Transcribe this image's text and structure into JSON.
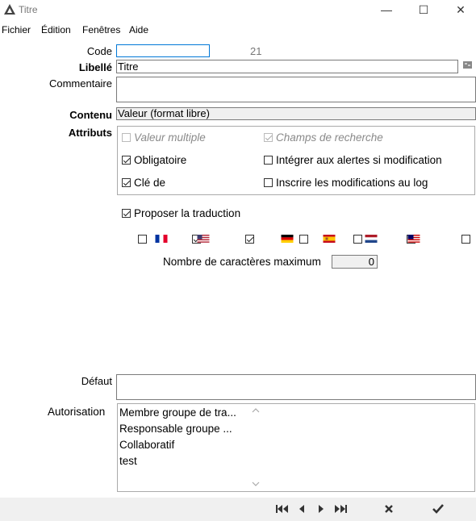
{
  "window": {
    "title": "Titre",
    "minimize": "—",
    "maximize": "☐",
    "close": "✕"
  },
  "menu": [
    "Fichier",
    "Édition",
    "Fenêtres",
    "Aide"
  ],
  "form": {
    "code_label": "Code",
    "code_value": "",
    "code_number": "21",
    "libelle_label": "Libellé",
    "libelle_value": "Titre",
    "commentaire_label": "Commentaire",
    "commentaire_value": "",
    "contenu_label": "Contenu",
    "contenu_value": "Valeur (format libre)",
    "attributs_label": "Attributs",
    "attributes": [
      {
        "label": "Valeur multiple",
        "checked": false,
        "disabled": true
      },
      {
        "label": "Champs de recherche",
        "checked": true,
        "disabled": true
      },
      {
        "label": "Obligatoire",
        "checked": true,
        "disabled": false
      },
      {
        "label": "Intégrer aux alertes si modification",
        "checked": false,
        "disabled": false
      },
      {
        "label": "Clé de",
        "checked": true,
        "disabled": false
      },
      {
        "label": "Inscrire les modifications au log",
        "checked": false,
        "disabled": false
      }
    ],
    "proposer_label": "Proposer la traduction",
    "proposer_checked": true,
    "languages": [
      {
        "flag": "fr",
        "checked": false
      },
      {
        "flag": "us",
        "checked": true
      },
      {
        "flag": "",
        "checked": true
      },
      {
        "flag": "de",
        "checked": false
      },
      {
        "flag": "es",
        "checked": false
      },
      {
        "flag": "nl",
        "checked": false
      },
      {
        "flag": "my",
        "checked": false
      }
    ],
    "max_chars_label": "Nombre de caractères maximum",
    "max_chars_value": "0",
    "defaut_label": "Défaut",
    "defaut_value": "",
    "autorisation_label": "Autorisation",
    "autorisations": [
      "Membre groupe de tra...",
      "Responsable groupe ...",
      "Collaboratif",
      "test"
    ]
  },
  "colors": {
    "accent_border": "#0078d7",
    "toolbar_bg": "#f0f0f0"
  }
}
